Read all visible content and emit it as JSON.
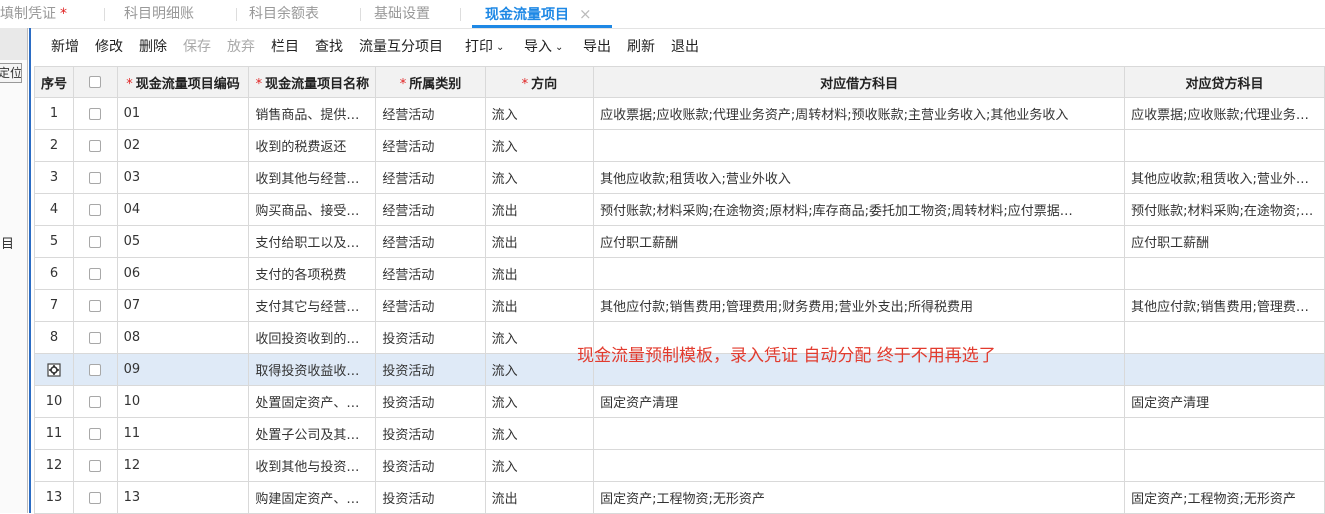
{
  "tabs": [
    {
      "label": "填制凭证",
      "modified_mark": "*"
    },
    {
      "label": "科目明细账"
    },
    {
      "label": "科目余额表"
    },
    {
      "label": "基础设置"
    },
    {
      "label": "现金流量项目",
      "close": "×"
    }
  ],
  "sidebar": {
    "locate_label": "定位",
    "side_label": "目"
  },
  "toolbar": {
    "new": "新增",
    "edit": "修改",
    "delete": "删除",
    "save": "保存",
    "discard": "放弃",
    "columns": "栏目",
    "find": "查找",
    "flow_split": "流量互分项目",
    "print": "打印",
    "import": "导入",
    "export": "导出",
    "refresh": "刷新",
    "exit": "退出"
  },
  "table": {
    "headers": {
      "seq": "序号",
      "code": "现金流量项目编码",
      "name": "现金流量项目名称",
      "category": "所属类别",
      "direction": "方向",
      "debit": "对应借方科目",
      "credit": "对应贷方科目",
      "required_mark": "*"
    },
    "rows": [
      {
        "seq": "1",
        "code": "01",
        "name": "销售商品、提供…",
        "category": "经营活动",
        "direction": "流入",
        "debit": "应收票据;应收账款;代理业务资产;周转材料;预收账款;主营业务收入;其他业务收入",
        "credit": "应收票据;应收账款;代理业务…"
      },
      {
        "seq": "2",
        "code": "02",
        "name": "收到的税费返还",
        "category": "经营活动",
        "direction": "流入",
        "debit": "",
        "credit": ""
      },
      {
        "seq": "3",
        "code": "03",
        "name": "收到其他与经营…",
        "category": "经营活动",
        "direction": "流入",
        "debit": "其他应收款;租赁收入;营业外收入",
        "credit": "其他应收款;租赁收入;营业外…"
      },
      {
        "seq": "4",
        "code": "04",
        "name": "购买商品、接受…",
        "category": "经营活动",
        "direction": "流出",
        "debit": "预付账款;材料采购;在途物资;原材料;库存商品;委托加工物资;周转材料;应付票据…",
        "credit": "预付账款;材料采购;在途物资;…"
      },
      {
        "seq": "5",
        "code": "05",
        "name": "支付给职工以及…",
        "category": "经营活动",
        "direction": "流出",
        "debit": "应付职工薪酬",
        "credit": "应付职工薪酬"
      },
      {
        "seq": "6",
        "code": "06",
        "name": "支付的各项税费",
        "category": "经营活动",
        "direction": "流出",
        "debit": "",
        "credit": ""
      },
      {
        "seq": "7",
        "code": "07",
        "name": "支付其它与经营…",
        "category": "经营活动",
        "direction": "流出",
        "debit": "其他应付款;销售费用;管理费用;财务费用;营业外支出;所得税费用",
        "credit": "其他应付款;销售费用;管理费…"
      },
      {
        "seq": "8",
        "code": "08",
        "name": "收回投资收到的…",
        "category": "投资活动",
        "direction": "流入",
        "debit": "",
        "credit": ""
      },
      {
        "seq": "",
        "code": "09",
        "name": "取得投资收益收…",
        "category": "投资活动",
        "direction": "流入",
        "debit": "",
        "credit": "",
        "selected": true
      },
      {
        "seq": "10",
        "code": "10",
        "name": "处置固定资产、…",
        "category": "投资活动",
        "direction": "流入",
        "debit": "固定资产清理",
        "credit": "固定资产清理"
      },
      {
        "seq": "11",
        "code": "11",
        "name": "处置子公司及其…",
        "category": "投资活动",
        "direction": "流入",
        "debit": "",
        "credit": ""
      },
      {
        "seq": "12",
        "code": "12",
        "name": "收到其他与投资…",
        "category": "投资活动",
        "direction": "流入",
        "debit": "",
        "credit": ""
      },
      {
        "seq": "13",
        "code": "13",
        "name": "购建固定资产、…",
        "category": "投资活动",
        "direction": "流出",
        "debit": "固定资产;工程物资;无形资产",
        "credit": "固定资产;工程物资;无形资产"
      }
    ]
  },
  "annotation": "现金流量预制模板，录入凭证 自动分配 终于不用再选了",
  "colors": {
    "accent": "#1e88e5",
    "annotation": "#e23b2e",
    "selected_row": "#dfeaf7",
    "header_bg": "#f2f2f2"
  }
}
